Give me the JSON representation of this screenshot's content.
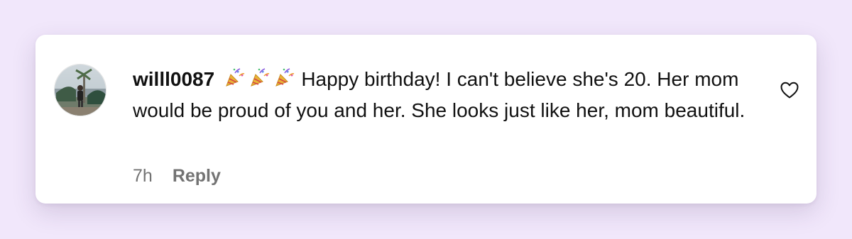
{
  "comment": {
    "username": "willl0087",
    "emoji": "🎉",
    "emoji_count": 3,
    "text": "Happy birthday! I can't believe she's 20. Her mom would be proud of you and her. She looks just like her, mom beautiful.",
    "timestamp": "7h",
    "reply_label": "Reply"
  },
  "icons": {
    "avatar": "profile-photo",
    "like": "heart-outline-icon"
  },
  "colors": {
    "background": "#f1e7fb",
    "card": "#ffffff",
    "text": "#111111",
    "meta": "#737373"
  }
}
